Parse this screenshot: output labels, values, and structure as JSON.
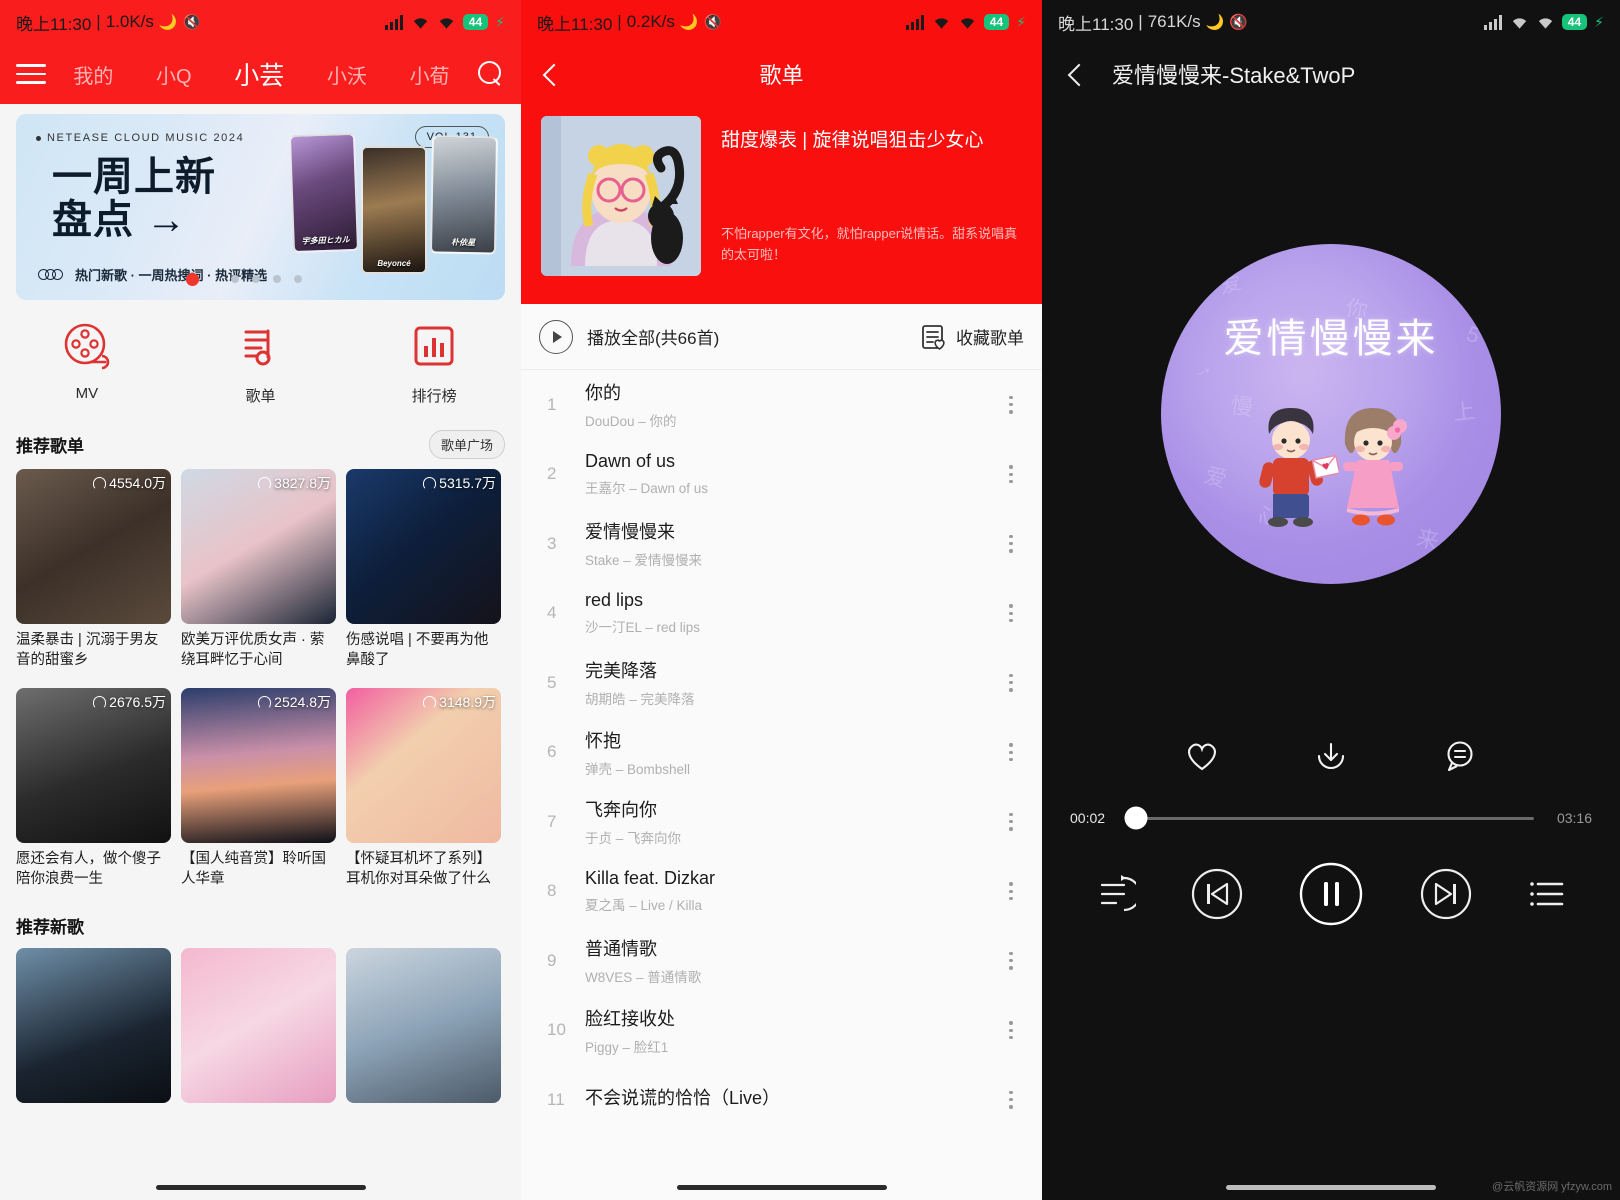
{
  "panel_home": {
    "status": {
      "time": "晚上11:30",
      "separator": "|",
      "netspeed": "1.0K/s",
      "battery": "44"
    },
    "nav": {
      "menu_icon": "hamburger-icon",
      "tabs": [
        {
          "label": "我的",
          "active": false
        },
        {
          "label": "小Q",
          "active": false
        },
        {
          "label": "小芸",
          "active": true
        },
        {
          "label": "小沃",
          "active": false
        },
        {
          "label": "小荀",
          "active": false
        }
      ],
      "search_icon": "search-icon"
    },
    "banner": {
      "eyebrow": "NETEASE CLOUD MUSIC 2024",
      "volume": "VOL.131",
      "title_line1": "一周上新",
      "title_line2": "盘点 →",
      "subtitle": "热门新歌 · 一周热搜词 · 热评精选",
      "artists": [
        "宇多田ヒカル",
        "Beyoncé",
        "朴依星"
      ]
    },
    "categories": [
      {
        "label": "MV",
        "icon": "film-reel-icon"
      },
      {
        "label": "歌单",
        "icon": "playlist-note-icon"
      },
      {
        "label": "排行榜",
        "icon": "bar-chart-icon"
      }
    ],
    "recommend_playlists": {
      "section_title": "推荐歌单",
      "action_label": "歌单广场",
      "items": [
        {
          "plays": "4554.0万",
          "title": "温柔暴击 | 沉溺于男友音的甜蜜乡"
        },
        {
          "plays": "3827.8万",
          "title": "欧美万评优质女声 · 萦绕耳畔忆于心间"
        },
        {
          "plays": "5315.7万",
          "title": "伤感说唱 | 不要再为他鼻酸了"
        },
        {
          "plays": "2676.5万",
          "title": "愿还会有人，做个傻子陪你浪费一生"
        },
        {
          "plays": "2524.8万",
          "title": "【国人纯音赏】聆听国人华章"
        },
        {
          "plays": "3148.9万",
          "title": "【怀疑耳机坏了系列】耳机你对耳朵做了什么"
        }
      ]
    },
    "recommend_songs": {
      "section_title": "推荐新歌"
    }
  },
  "panel_playlist": {
    "status": {
      "time": "晚上11:30",
      "separator": "|",
      "netspeed": "0.2K/s",
      "battery": "44"
    },
    "nav": {
      "back_icon": "back-arrow-icon",
      "title": "歌单"
    },
    "hero": {
      "name": "甜度爆表 | 旋律说唱狙击少女心",
      "description": "不怕rapper有文化，就怕rapper说情话。甜系说唱真的太可啦！",
      "cover_alt": "sailor-moon-cover"
    },
    "toolbar": {
      "play_all_label": "播放全部(共66首)",
      "play_icon": "play-circle-icon",
      "favorite_label": "收藏歌单",
      "favorite_icon": "collect-playlist-icon"
    },
    "songs": [
      {
        "num": "1",
        "title": "你的",
        "artist": "DouDou – 你的"
      },
      {
        "num": "2",
        "title": "Dawn of us",
        "artist": "王嘉尔 – Dawn of us"
      },
      {
        "num": "3",
        "title": "爱情慢慢来",
        "artist": "Stake – 爱情慢慢来"
      },
      {
        "num": "4",
        "title": "red lips",
        "artist": "沙一汀EL – red lips"
      },
      {
        "num": "5",
        "title": "完美降落",
        "artist": "胡期皓 – 完美降落"
      },
      {
        "num": "6",
        "title": "怀抱",
        "artist": "弹壳 – Bombshell"
      },
      {
        "num": "7",
        "title": "飞奔向你",
        "artist": "于贞 – 飞奔向你"
      },
      {
        "num": "8",
        "title": "Killa feat. Dizkar",
        "artist": "夏之禹 – Live / Killa"
      },
      {
        "num": "9",
        "title": "普通情歌",
        "artist": "W8VES – 普通情歌"
      },
      {
        "num": "10",
        "title": "脸红接收处",
        "artist": "Piggy – 脸红1"
      },
      {
        "num": "11",
        "title": "不会说谎的恰恰（Live）",
        "artist": ""
      }
    ]
  },
  "panel_player": {
    "status": {
      "time": "晚上11:30",
      "separator": "|",
      "netspeed": "761K/s",
      "battery": "44"
    },
    "nav": {
      "back_icon": "back-arrow-icon",
      "title": "爱情慢慢来-Stake&TwoP"
    },
    "cover": {
      "title": "爱情慢慢来",
      "alt": "boy-girl-love-letter-illustration"
    },
    "actions": [
      {
        "icon": "heart-icon",
        "name": "like"
      },
      {
        "icon": "download-icon",
        "name": "download"
      },
      {
        "icon": "comment-icon",
        "name": "comment"
      }
    ],
    "progress": {
      "current": "00:02",
      "total": "03:16",
      "percent": 2
    },
    "controls": [
      {
        "icon": "playlist-loop-icon",
        "name": "play-mode"
      },
      {
        "icon": "previous-icon",
        "name": "previous"
      },
      {
        "icon": "pause-icon",
        "name": "play-pause"
      },
      {
        "icon": "next-icon",
        "name": "next"
      },
      {
        "icon": "queue-list-icon",
        "name": "queue"
      }
    ]
  },
  "watermark": "@云帆资源网 yfzyw.com"
}
